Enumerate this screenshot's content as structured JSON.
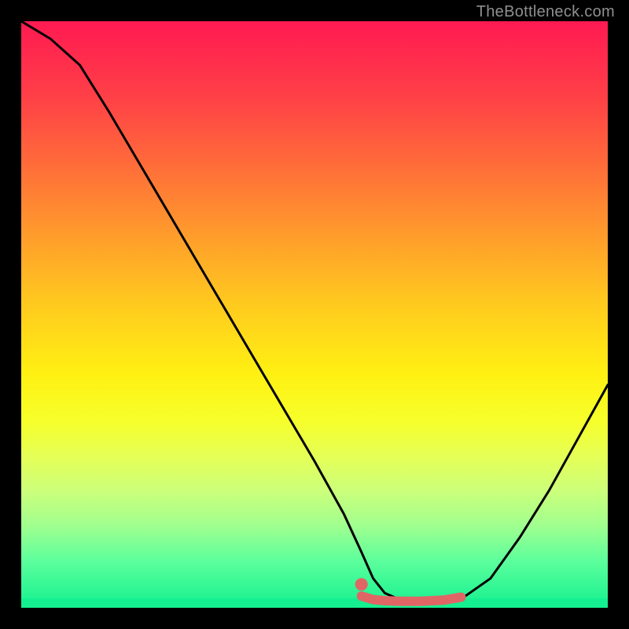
{
  "watermark": "TheBottleneck.com",
  "colors": {
    "frame": "#000000",
    "curve": "#000000",
    "dot": "#e06666",
    "segment": "#e06666",
    "gradient_top": "#ff1a52",
    "gradient_bottom": "#14f08f"
  },
  "chart_data": {
    "type": "line",
    "title": "",
    "xlabel": "",
    "ylabel": "",
    "xlim": [
      0,
      100
    ],
    "ylim": [
      0,
      100
    ],
    "grid": false,
    "series": [
      {
        "name": "bottleneck-curve",
        "x": [
          0,
          5,
          10,
          15,
          20,
          25,
          30,
          35,
          40,
          45,
          50,
          55,
          58,
          60,
          62,
          65,
          68,
          72,
          75,
          80,
          85,
          90,
          95,
          100
        ],
        "y": [
          100.0,
          97.0,
          92.5,
          84.5,
          76.0,
          67.5,
          59.0,
          50.5,
          42.0,
          33.5,
          25.0,
          16.0,
          9.5,
          5.0,
          2.5,
          1.2,
          0.8,
          0.8,
          1.5,
          5.0,
          12.0,
          20.0,
          29.0,
          38.0
        ]
      },
      {
        "name": "highlighted-segment",
        "x": [
          58,
          60,
          62,
          65,
          68,
          72,
          75
        ],
        "y": [
          2.0,
          1.4,
          1.2,
          1.1,
          1.1,
          1.3,
          1.8
        ]
      }
    ],
    "annotations": [
      {
        "type": "dot",
        "name": "start-dot",
        "x": 58,
        "y": 4.0,
        "color": "#e06666"
      }
    ],
    "legend": false
  }
}
